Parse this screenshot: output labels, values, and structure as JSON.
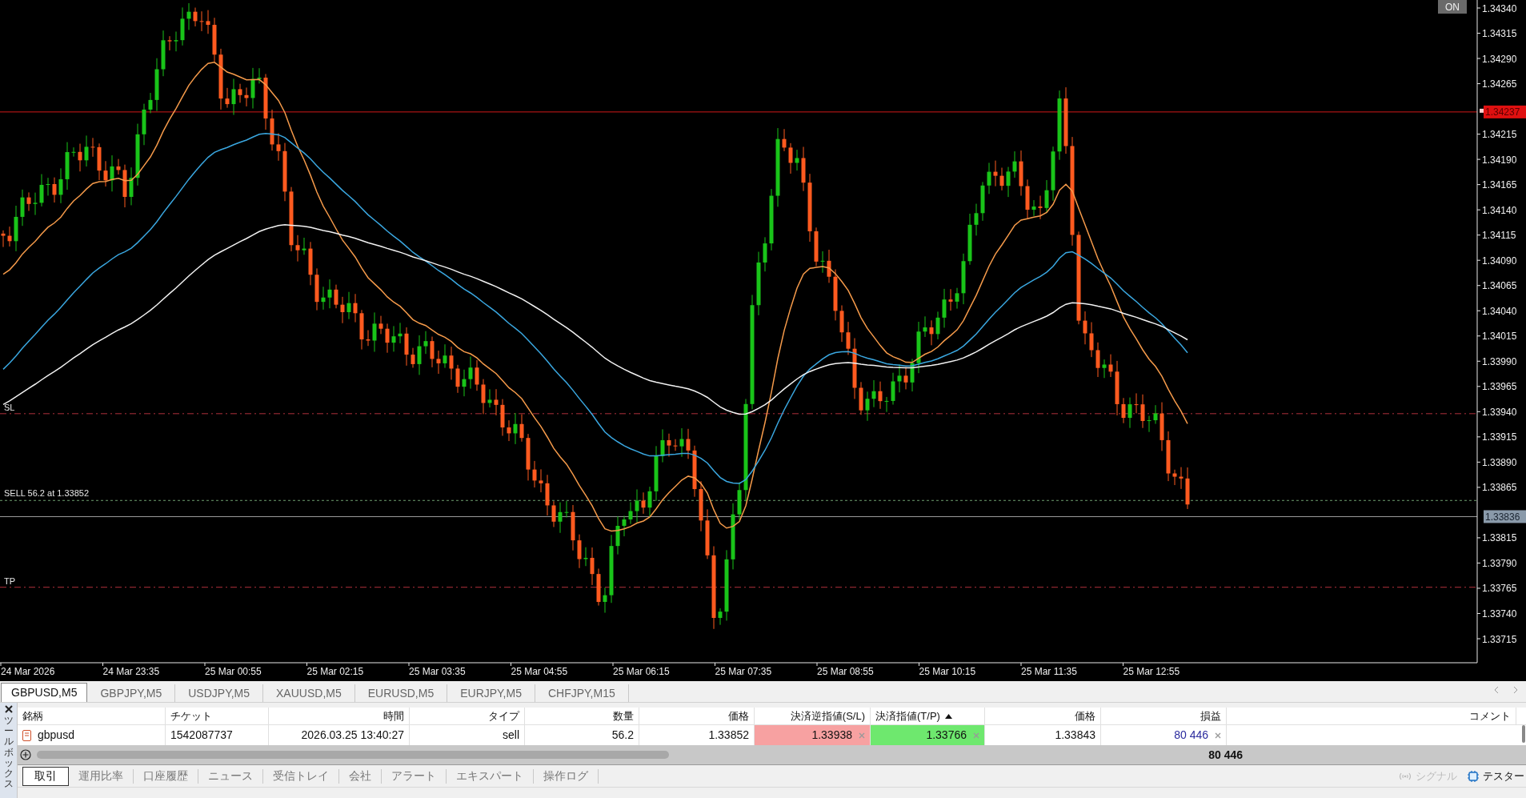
{
  "chart": {
    "on_button": "ON",
    "price_ticks": [
      "1.34340",
      "1.34315",
      "1.34290",
      "1.34265",
      "1.34215",
      "1.34190",
      "1.34165",
      "1.34140",
      "1.34115",
      "1.34090",
      "1.34065",
      "1.34040",
      "1.34015",
      "1.33990",
      "1.33965",
      "1.33940",
      "1.33915",
      "1.33890",
      "1.33865",
      "1.33815",
      "1.33790",
      "1.33765",
      "1.33740",
      "1.33715"
    ],
    "ask_label": "1.34237",
    "bid_label": "1.33836",
    "sl_label": "SL",
    "tp_label": "TP",
    "order_label": "SELL 56.2 at 1.33852",
    "time_ticks": [
      "24 Mar 2026",
      "24 Mar 23:35",
      "25 Mar 00:55",
      "25 Mar 02:15",
      "25 Mar 03:35",
      "25 Mar 04:55",
      "25 Mar 06:15",
      "25 Mar 07:35",
      "25 Mar 08:55",
      "25 Mar 10:15",
      "25 Mar 11:35",
      "25 Mar 12:55"
    ]
  },
  "chart_tabs": [
    {
      "label": "GBPUSD,M5",
      "selected": true
    },
    {
      "label": "GBPJPY,M5",
      "selected": false
    },
    {
      "label": "USDJPY,M5",
      "selected": false
    },
    {
      "label": "XAUUSD,M5",
      "selected": false
    },
    {
      "label": "EURUSD,M5",
      "selected": false
    },
    {
      "label": "EURJPY,M5",
      "selected": false
    },
    {
      "label": "CHFJPY,M15",
      "selected": false
    }
  ],
  "toolbox": {
    "title": "ツールボックス",
    "columns": [
      {
        "label": "銘柄",
        "sorted": false
      },
      {
        "label": "チケット",
        "sorted": false
      },
      {
        "label": "時間",
        "sorted": false
      },
      {
        "label": "タイプ",
        "sorted": false
      },
      {
        "label": "数量",
        "sorted": false
      },
      {
        "label": "価格",
        "sorted": false
      },
      {
        "label": "決済逆指値(S/L)",
        "sorted": false
      },
      {
        "label": "決済指値(T/P)",
        "sorted": true
      },
      {
        "label": "価格",
        "sorted": false
      },
      {
        "label": "損益",
        "sorted": false
      },
      {
        "label": "コメント",
        "sorted": false
      }
    ],
    "rows": [
      {
        "symbol": "gbpusd",
        "ticket": "1542087737",
        "time": "2026.03.25 13:40:27",
        "type": "sell",
        "volume": "56.2",
        "price": "1.33852",
        "sl": "1.33938",
        "tp": "1.33766",
        "current_price": "1.33843",
        "profit": "80 446"
      }
    ],
    "total_profit": "80 446",
    "tabs": [
      {
        "label": "取引",
        "selected": true
      },
      {
        "label": "運用比率",
        "selected": false
      },
      {
        "label": "口座履歴",
        "selected": false
      },
      {
        "label": "ニュース",
        "selected": false
      },
      {
        "label": "受信トレイ",
        "selected": false
      },
      {
        "label": "会社",
        "selected": false
      },
      {
        "label": "アラート",
        "selected": false
      },
      {
        "label": "エキスパート",
        "selected": false
      },
      {
        "label": "操作ログ",
        "selected": false
      }
    ],
    "signal_label": "シグナル",
    "signal_disabled": true,
    "tester_label": "テスター"
  }
}
